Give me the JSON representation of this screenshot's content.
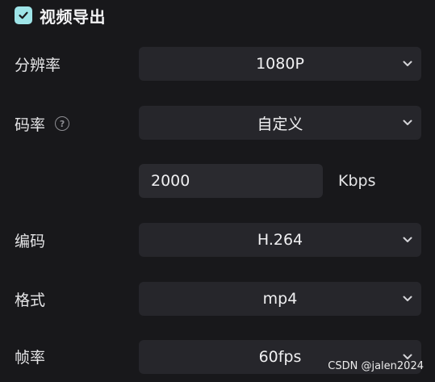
{
  "section": {
    "title": "视频导出",
    "checked": true,
    "checkbox_color": "#9ee4e8",
    "check_icon": "checkmark-icon"
  },
  "fields": {
    "resolution": {
      "label": "分辨率",
      "value": "1080P"
    },
    "bitrate": {
      "label": "码率",
      "value": "自定义",
      "help_icon": "question-circle-icon"
    },
    "bitrate_custom": {
      "value": "2000",
      "unit": "Kbps"
    },
    "codec": {
      "label": "编码",
      "value": "H.264"
    },
    "format": {
      "label": "格式",
      "value": "mp4"
    },
    "framerate": {
      "label": "帧率",
      "value": "60fps"
    }
  },
  "dropdown_icon": "chevron-down-icon",
  "watermark": "CSDN @jalen2024",
  "colors": {
    "background": "#18181b",
    "control": "#26262b",
    "accent": "#9ee4e8"
  }
}
